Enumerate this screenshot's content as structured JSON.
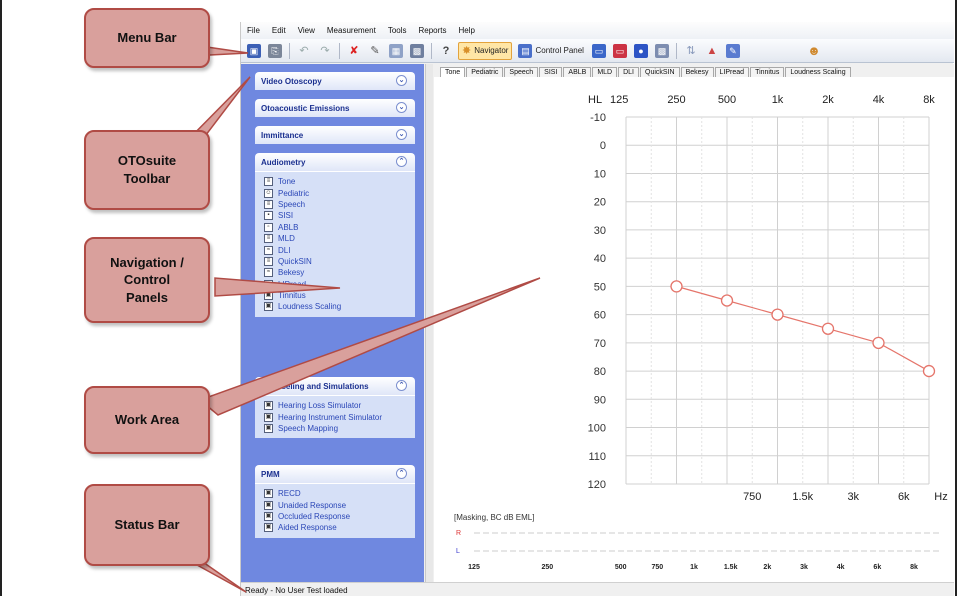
{
  "menubar": {
    "items": [
      "File",
      "Edit",
      "View",
      "Measurement",
      "Tools",
      "Reports",
      "Help"
    ]
  },
  "toolbar": {
    "navigator_label": "Navigator",
    "control_panel_label": "Control Panel",
    "icons": [
      "save-icon",
      "print-icon",
      "undo-icon",
      "redo-icon",
      "delete-icon",
      "edit-icon",
      "compare-icon",
      "monitor-icon",
      "help-icon",
      "navigator-icon",
      "control-panel-icon",
      "window-icon",
      "window-red-icon",
      "mask-icon",
      "screen-icon",
      "sort-icon",
      "chart-icon",
      "edit-chart-icon",
      "user-icon"
    ]
  },
  "nav": {
    "sections": [
      {
        "title": "Video Otoscopy",
        "collapsed": true,
        "items": []
      },
      {
        "title": "Otoacoustic Emissions",
        "collapsed": true,
        "items": []
      },
      {
        "title": "Immittance",
        "collapsed": true,
        "items": []
      },
      {
        "title": "Audiometry",
        "collapsed": false,
        "items": [
          "Tone",
          "Pediatric",
          "Speech",
          "SISI",
          "ABLB",
          "MLD",
          "DLI",
          "QuickSIN",
          "Bekesy",
          "LIPread",
          "Tinnitus",
          "Loudness Scaling"
        ]
      },
      {
        "title": "Counseling and Simulations",
        "collapsed": false,
        "items": [
          "Hearing Loss Simulator",
          "Hearing Instrument Simulator",
          "Speech Mapping"
        ]
      },
      {
        "title": "PMM",
        "collapsed": false,
        "items": [
          "RECD",
          "Unaided Response",
          "Occluded Response",
          "Aided Response"
        ]
      }
    ]
  },
  "tabs": [
    "Tone",
    "Pediatric",
    "Speech",
    "SISI",
    "ABLB",
    "MLD",
    "DLI",
    "QuickSIN",
    "Bekesy",
    "LIPread",
    "Tinnitus",
    "Loudness Scaling"
  ],
  "active_tab": "Tone",
  "chart_data": {
    "type": "line",
    "title": "",
    "y_axis_label": "HL",
    "top_freq_labels": [
      "125",
      "250",
      "500",
      "1k",
      "2k",
      "4k",
      "8k"
    ],
    "bottom_freq_labels": [
      "750",
      "1.5k",
      "3k",
      "6k",
      "Hz"
    ],
    "y_ticks": [
      -10,
      0,
      10,
      20,
      30,
      40,
      50,
      60,
      70,
      80,
      90,
      100,
      110,
      120
    ],
    "ylim": [
      -10,
      120
    ],
    "y_inverted": true,
    "grid": true,
    "series": [
      {
        "color": "#e5756b",
        "marker": "circle",
        "x": [
          "250",
          "500",
          "1k",
          "2k",
          "4k",
          "8k"
        ],
        "values": [
          50,
          55,
          60,
          65,
          70,
          80
        ]
      }
    ]
  },
  "masking": {
    "label": "[Masking, BC dB EML]",
    "r_label": "R",
    "l_label": "L",
    "freq_labels": [
      "125",
      "250",
      "500",
      "750",
      "1k",
      "1.5k",
      "2k",
      "3k",
      "4k",
      "6k",
      "8k"
    ]
  },
  "status": {
    "text": "Ready - No User Test loaded"
  },
  "callouts": {
    "menu_bar": "Menu Bar",
    "otosuite_toolbar": "OTOsuite Toolbar",
    "navigation": "Navigation / Control Panels",
    "work_area": "Work Area",
    "status_bar": "Status Bar"
  },
  "colors": {
    "nav_bg": "#6f88e0",
    "callout_bg": "#d9a09c",
    "callout_border": "#b04b45",
    "curve": "#e5756b"
  }
}
